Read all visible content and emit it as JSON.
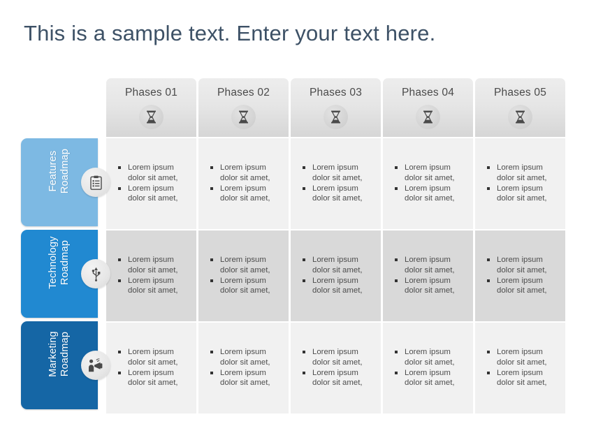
{
  "title": "This is a sample text. Enter your text here.",
  "colors": {
    "title": "#3d5166",
    "row_light": "#f1f1f1",
    "row_dark": "#d9d9d9",
    "tab_features": "#7db9e3",
    "tab_technology": "#2189d1",
    "tab_marketing": "#1566a5"
  },
  "columns": [
    {
      "label": "Phases 01",
      "icon": "hourglass-icon"
    },
    {
      "label": "Phases 02",
      "icon": "hourglass-icon"
    },
    {
      "label": "Phases 03",
      "icon": "hourglass-icon"
    },
    {
      "label": "Phases 04",
      "icon": "hourglass-icon"
    },
    {
      "label": "Phases 05",
      "icon": "hourglass-icon"
    }
  ],
  "rows": [
    {
      "label": "Features\nRoadmap",
      "label_line1": "Features",
      "label_line2": "Roadmap",
      "icon": "clipboard-icon",
      "shade": "light",
      "cells": [
        {
          "bullets": [
            "Lorem ipsum dolor sit amet,",
            "Lorem ipsum dolor sit amet,"
          ]
        },
        {
          "bullets": [
            "Lorem ipsum dolor sit amet,",
            "Lorem ipsum dolor sit amet,"
          ]
        },
        {
          "bullets": [
            "Lorem ipsum dolor sit amet,",
            "Lorem ipsum dolor sit amet,"
          ]
        },
        {
          "bullets": [
            "Lorem ipsum dolor sit amet,",
            "Lorem ipsum dolor sit amet,"
          ]
        },
        {
          "bullets": [
            "Lorem ipsum dolor sit amet,",
            "Lorem ipsum dolor sit amet,"
          ]
        }
      ]
    },
    {
      "label": "Technology\nRoadmap",
      "label_line1": "Technology",
      "label_line2": "Roadmap",
      "icon": "usb-icon",
      "shade": "dark",
      "cells": [
        {
          "bullets": [
            "Lorem ipsum dolor sit amet,",
            "Lorem ipsum dolor sit amet,"
          ]
        },
        {
          "bullets": [
            "Lorem ipsum dolor sit amet,",
            "Lorem ipsum dolor sit amet,"
          ]
        },
        {
          "bullets": [
            "Lorem ipsum dolor sit amet,",
            "Lorem ipsum dolor sit amet,"
          ]
        },
        {
          "bullets": [
            "Lorem ipsum dolor sit amet,",
            "Lorem ipsum dolor sit amet,"
          ]
        },
        {
          "bullets": [
            "Lorem ipsum dolor sit amet,",
            "Lorem ipsum dolor sit amet,"
          ]
        }
      ]
    },
    {
      "label": "Marketing\nRoadmap",
      "label_line1": "Marketing",
      "label_line2": "Roadmap",
      "icon": "megaphone-person-icon",
      "shade": "light",
      "cells": [
        {
          "bullets": [
            "Lorem ipsum dolor sit amet,",
            "Lorem ipsum dolor sit amet,"
          ]
        },
        {
          "bullets": [
            "Lorem ipsum dolor sit amet,",
            "Lorem ipsum dolor sit amet,"
          ]
        },
        {
          "bullets": [
            "Lorem ipsum dolor sit amet,",
            "Lorem ipsum dolor sit amet,"
          ]
        },
        {
          "bullets": [
            "Lorem ipsum dolor sit amet,",
            "Lorem ipsum dolor sit amet,"
          ]
        },
        {
          "bullets": [
            "Lorem ipsum dolor sit amet,",
            "Lorem ipsum dolor sit amet,"
          ]
        }
      ]
    }
  ]
}
